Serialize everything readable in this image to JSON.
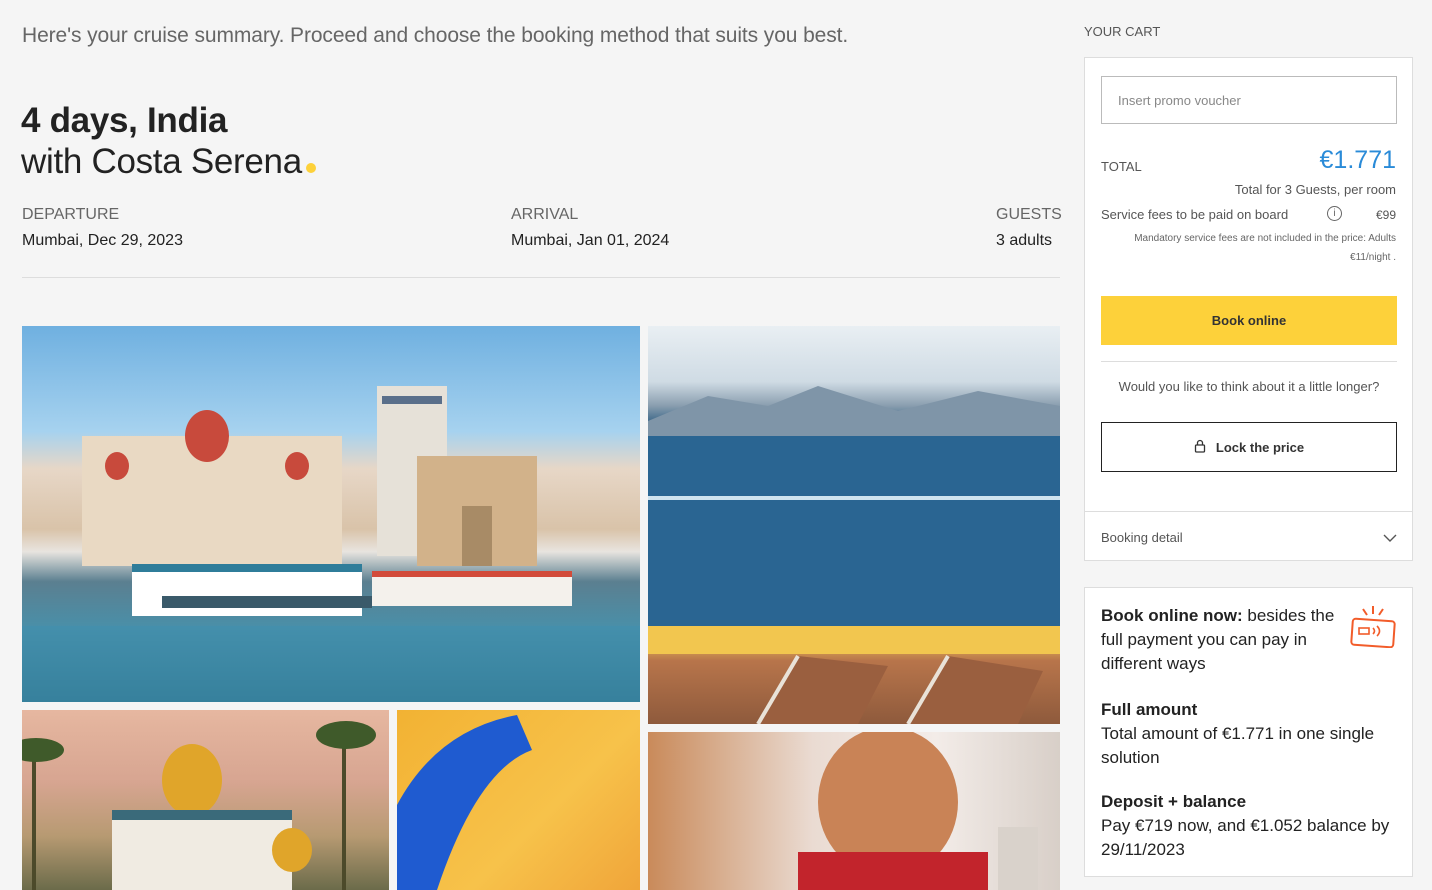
{
  "intro": "Here's your cruise summary. Proceed and choose the booking method that suits you best.",
  "title": {
    "line1": "4 days, India",
    "line2": "with Costa Serena",
    "dot_color": "#fdd13a"
  },
  "trip": {
    "departure": {
      "label": "DEPARTURE",
      "value": "Mumbai, Dec 29, 2023"
    },
    "arrival": {
      "label": "ARRIVAL",
      "value": "Mumbai, Jan 01, 2024"
    },
    "guests": {
      "label": "GUESTS",
      "value": "3 adults"
    }
  },
  "cart": {
    "title": "YOUR CART",
    "promo_placeholder": "Insert promo voucher",
    "total_label": "TOTAL",
    "total_value": "€1.771",
    "total_sub": "Total for 3 Guests, per room",
    "fees_label": "Service fees to be paid on board",
    "fees_value": "€99",
    "fees_note": "Mandatory service fees are not included in the price: Adults €11/night .",
    "book_online": "Book online",
    "think_text": "Would you like to think about it a little longer?",
    "lock_price": "Lock the price",
    "booking_detail": "Booking detail"
  },
  "payment_info": {
    "head_bold": "Book online now:",
    "head_rest": " besides the full payment you can pay in different ways",
    "full_title": "Full amount",
    "full_text": "Total amount of €1.771 in one single solution",
    "deposit_title": "Deposit + balance",
    "deposit_text": "Pay €719 now, and €1.052 balance by 29/11/2023"
  },
  "colors": {
    "accent_yellow": "#fdd13a",
    "price_blue": "#2a8bd8",
    "icon_orange": "#f25c2a"
  },
  "icons": {
    "info": "info-icon",
    "lock": "lock-icon",
    "chevron": "chevron-down-icon",
    "payment": "card-payment-icon"
  }
}
